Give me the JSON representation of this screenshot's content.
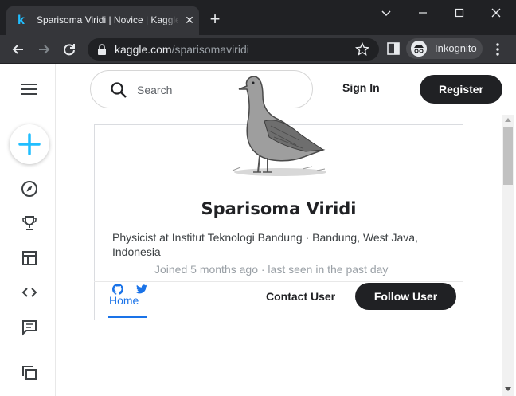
{
  "browser": {
    "tab_title": "Sparisoma Viridi | Novice | Kaggle",
    "url_host": "kaggle.com",
    "url_path": "/sparisomaviridi",
    "profile_label": "Inkognito"
  },
  "header": {
    "search_placeholder": "Search",
    "signin_label": "Sign In",
    "register_label": "Register"
  },
  "profile": {
    "name": "Sparisoma Viridi",
    "bio": "Physicist at Institut Teknologi Bandung · Bandung, West Java, Indonesia",
    "joined": "Joined 5 months ago · last seen in the past day",
    "home_tab": "Home",
    "contact_label": "Contact User",
    "follow_label": "Follow User"
  },
  "icons": {
    "favicon": "k",
    "tab_close": "✕",
    "new_tab": "+",
    "accent": "#20beff",
    "link": "#1a73e8"
  }
}
